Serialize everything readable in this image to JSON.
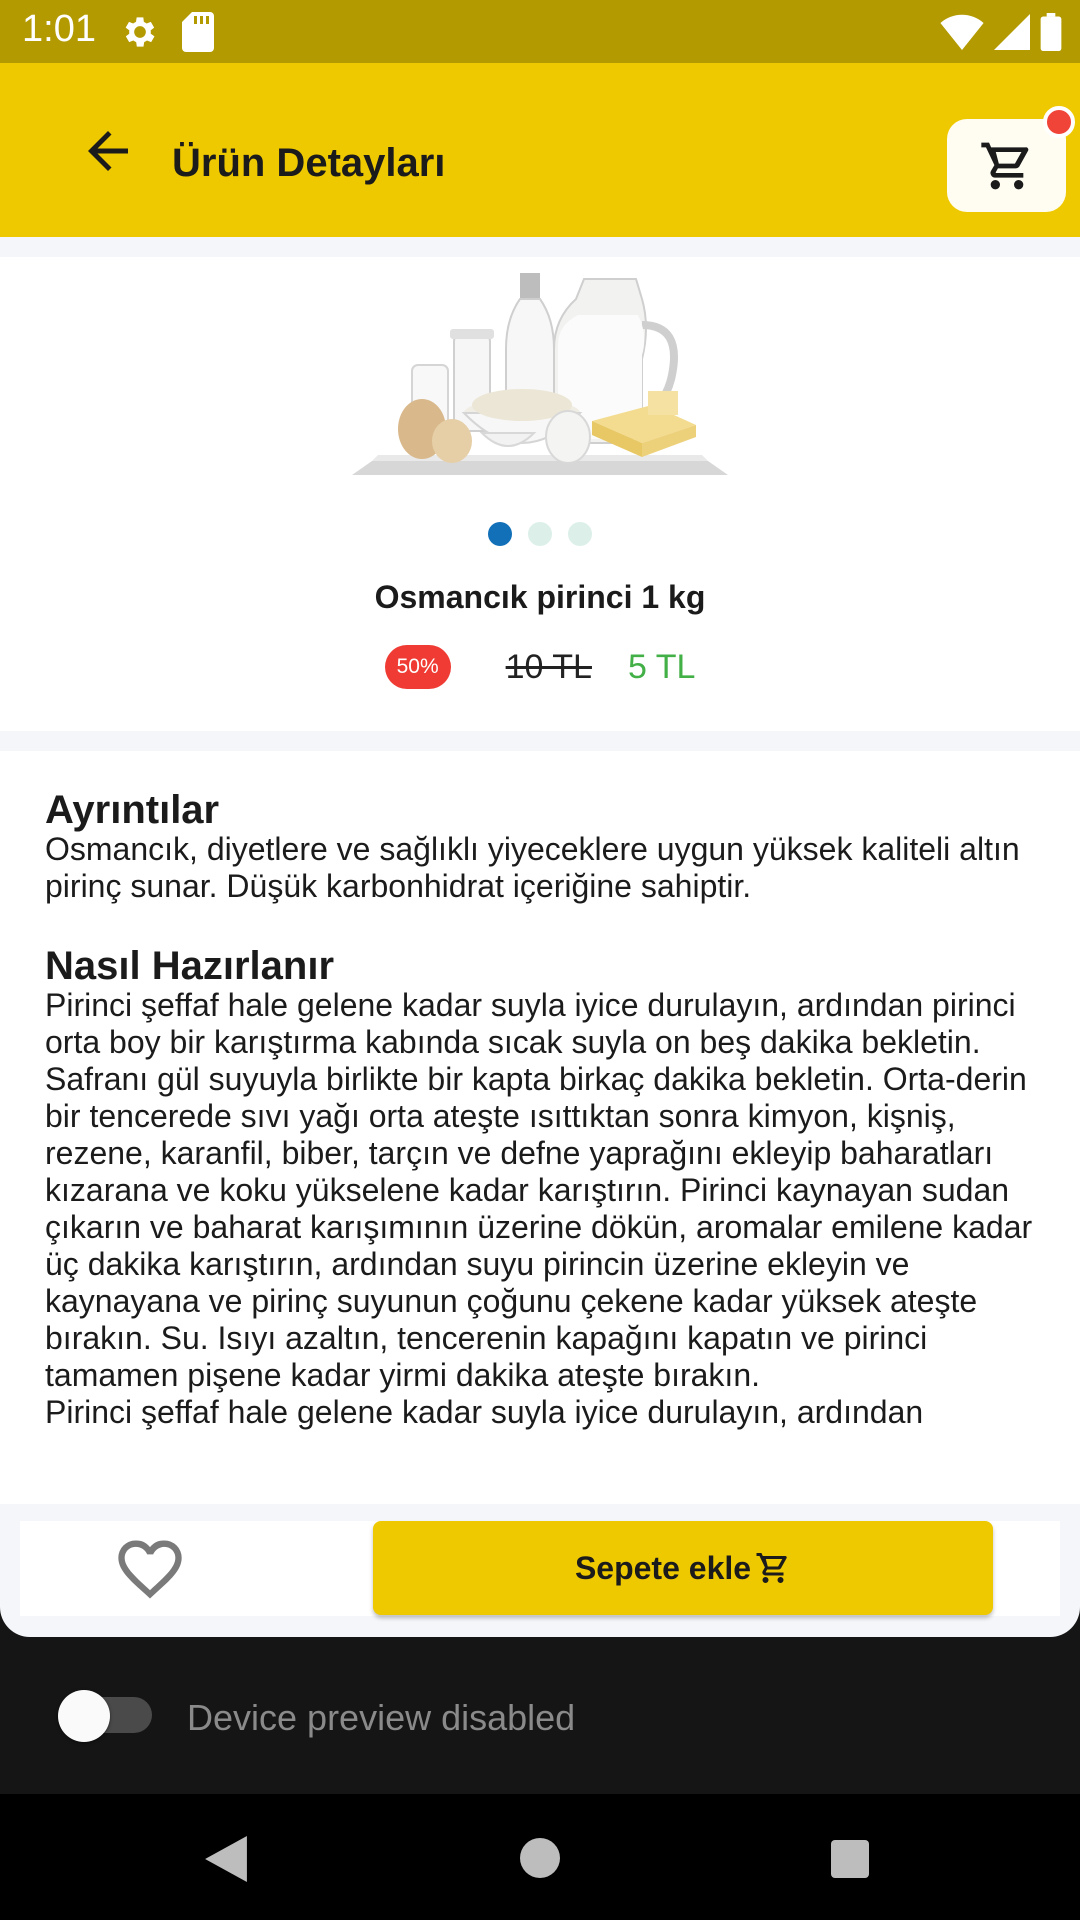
{
  "status_bar": {
    "time": "1:01",
    "icons": [
      "settings-icon",
      "sd-card-icon",
      "wifi-icon",
      "signal-icon",
      "battery-icon"
    ]
  },
  "app_bar": {
    "title": "Ürün Detayları",
    "back_icon": "arrow-back-icon",
    "cart_icon": "shopping-cart-icon",
    "cart_badge_color": "#f04438"
  },
  "product": {
    "image": "dairy-products-image",
    "carousel": {
      "count": 3,
      "active_index": 0
    },
    "name": "Osmancık pirinci 1 kg",
    "discount_badge": "50%",
    "old_price": "10 TL",
    "new_price": "5 TL"
  },
  "details": {
    "details_title": "Ayrıntılar",
    "details_text": "Osmancık, diyetlere ve sağlıklı yiyeceklere uygun yüksek kaliteli altın pirinç sunar. Düşük karbonhidrat içeriğine sahiptir.",
    "preparation_title": "Nasıl Hazırlanır",
    "preparation_text": "Pirinci şeffaf hale gelene kadar suyla iyice durulayın, ardından pirinci orta boy bir karıştırma kabında sıcak suyla on beş dakika bekletin. Safranı gül suyuyla birlikte bir kapta birkaç dakika bekletin. Orta-derin bir tencerede sıvı yağı orta ateşte ısıttıktan sonra kimyon, kişniş, rezene, karanfil, biber, tarçın ve defne yaprağını ekleyip baharatları kızarana ve koku yükselene kadar karıştırın. Pirinci kaynayan sudan çıkarın ve baharat karışımının üzerine dökün, aromalar emilene kadar üç dakika karıştırın, ardından suyu pirincin üzerine ekleyin ve kaynayana ve pirinç suyunun çoğunu çekene kadar yüksek ateşte bırakın. Su. Isıyı azaltın, tencerenin kapağını kapatın ve pirinci tamamen pişene kadar yirmi dakika ateşte bırakın.",
    "preparation_text_repeat": "Pirinci şeffaf hale gelene kadar suyla iyice durulayın, ardından"
  },
  "actions": {
    "favorite_icon": "heart-outline-icon",
    "add_to_cart_label": "Sepete ekle",
    "add_to_cart_icon": "cart-icon"
  },
  "device_preview": {
    "label": "Device preview disabled",
    "enabled": false
  },
  "nav_bar": {
    "icons": [
      "nav-back-icon",
      "nav-home-icon",
      "nav-recents-icon"
    ]
  },
  "colors": {
    "status_bar": "#b39a00",
    "accent": "#efc900",
    "discount": "#ef3b33",
    "new_price": "#43b047",
    "carousel_active": "#1170b8"
  }
}
